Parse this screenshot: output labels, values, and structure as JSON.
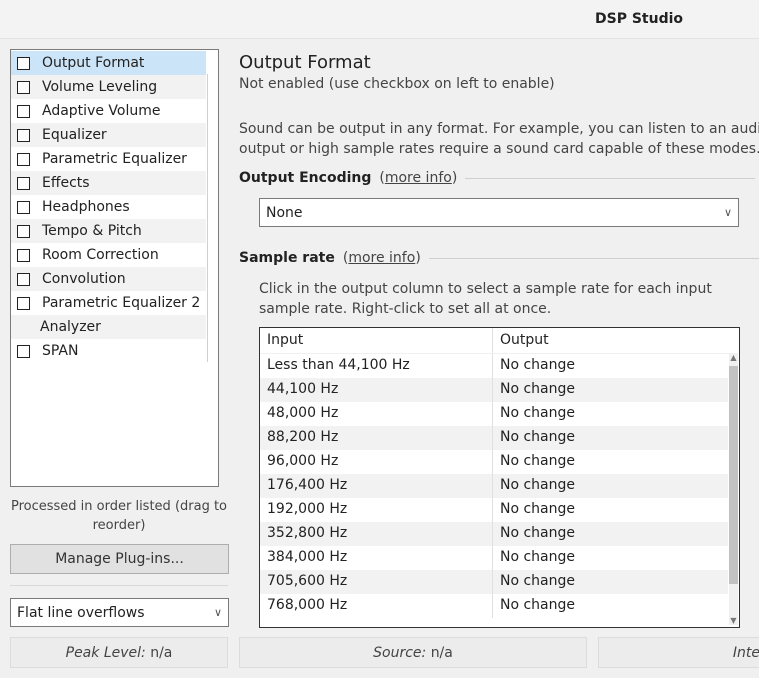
{
  "window": {
    "title": "DSP Studio"
  },
  "plugins": [
    {
      "label": "Output Format",
      "checkbox": true,
      "selected": true
    },
    {
      "label": "Volume Leveling",
      "checkbox": true
    },
    {
      "label": "Adaptive Volume",
      "checkbox": true
    },
    {
      "label": "Equalizer",
      "checkbox": true
    },
    {
      "label": "Parametric Equalizer",
      "checkbox": true
    },
    {
      "label": "Effects",
      "checkbox": true
    },
    {
      "label": "Headphones",
      "checkbox": true
    },
    {
      "label": "Tempo & Pitch",
      "checkbox": true
    },
    {
      "label": "Room Correction",
      "checkbox": true
    },
    {
      "label": "Convolution",
      "checkbox": true
    },
    {
      "label": "Parametric Equalizer 2",
      "checkbox": true
    },
    {
      "label": "Analyzer",
      "checkbox": false
    },
    {
      "label": "SPAN",
      "checkbox": true
    }
  ],
  "left": {
    "order_note": "Processed in order listed (drag to reorder)",
    "manage_button": "Manage Plug-ins...",
    "overflow_select": "Flat line overflows"
  },
  "panel": {
    "title": "Output Format",
    "subtitle": "Not enabled (use checkbox on left to enable)",
    "desc_line1": "Sound can be output in any format.  For example, you can listen to an audio CD",
    "desc_line2": "output or high sample rates require a sound card capable of these modes.",
    "encoding_heading": "Output Encoding",
    "encoding_more": "more info",
    "encoding_value": "None",
    "rate_heading": "Sample rate",
    "rate_more": "more info",
    "rate_note": "Click in the output column to select a sample rate for each input sample rate.  Right-click to set all at once."
  },
  "table": {
    "headers": [
      "Input",
      "Output"
    ],
    "rows": [
      [
        "Less than 44,100 Hz",
        "No change"
      ],
      [
        "44,100 Hz",
        "No change"
      ],
      [
        "48,000 Hz",
        "No change"
      ],
      [
        "88,200 Hz",
        "No change"
      ],
      [
        "96,000 Hz",
        "No change"
      ],
      [
        "176,400 Hz",
        "No change"
      ],
      [
        "192,000 Hz",
        "No change"
      ],
      [
        "352,800 Hz",
        "No change"
      ],
      [
        "384,000 Hz",
        "No change"
      ],
      [
        "705,600 Hz",
        "No change"
      ],
      [
        "768,000 Hz",
        "No change"
      ]
    ]
  },
  "status": {
    "peak_label": "Peak Level:",
    "peak_value": "n/a",
    "source_label": "Source:",
    "source_value": "n/a",
    "third_label": "Inte"
  },
  "colors": {
    "selection": "#cce4f7",
    "alt_row": "#f2f2f2"
  }
}
